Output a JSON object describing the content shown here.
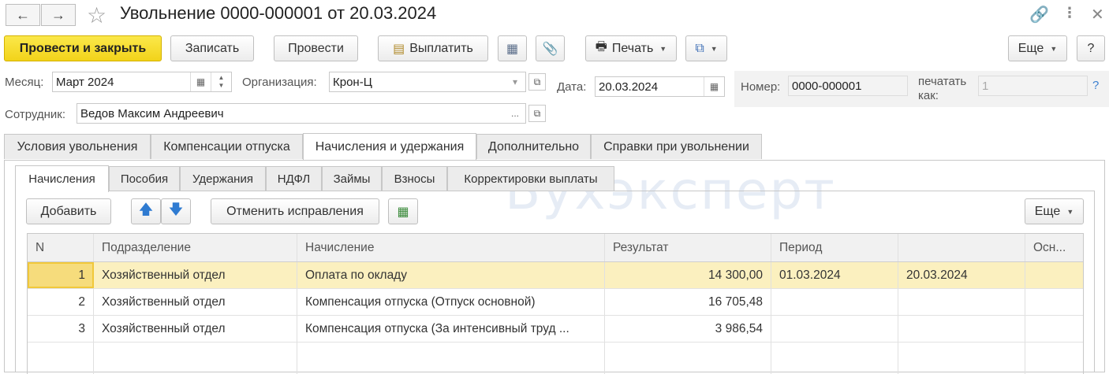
{
  "window": {
    "title": "Увольнение 0000-000001 от 20.03.2024",
    "back_label": "←",
    "forward_label": "→"
  },
  "toolbar": {
    "post_close": "Провести и закрыть",
    "save": "Записать",
    "post": "Провести",
    "pay": "Выплатить",
    "print": "Печать",
    "more": "Еще",
    "help": "?"
  },
  "form": {
    "month_label": "Месяц:",
    "month_value": "Март 2024",
    "org_label": "Организация:",
    "org_value": "Крон-Ц",
    "date_label": "Дата:",
    "date_value": "20.03.2024",
    "number_label": "Номер:",
    "number_value": "0000-000001",
    "print_as_label_1": "печатать",
    "print_as_label_2": "как:",
    "print_as_value": "1",
    "print_as_help": "?",
    "employee_label": "Сотрудник:",
    "employee_value": "Ведов Максим Андреевич",
    "ellipsis": "..."
  },
  "tabs": [
    {
      "label": "Условия увольнения"
    },
    {
      "label": "Компенсации отпуска"
    },
    {
      "label": "Начисления и удержания"
    },
    {
      "label": "Дополнительно"
    },
    {
      "label": "Справки при увольнении"
    }
  ],
  "subtabs": [
    {
      "label": "Начисления"
    },
    {
      "label": "Пособия"
    },
    {
      "label": "Удержания"
    },
    {
      "label": "НДФЛ"
    },
    {
      "label": "Займы"
    },
    {
      "label": "Взносы"
    },
    {
      "label": "Корректировки выплаты"
    }
  ],
  "grid_toolbar": {
    "add": "Добавить",
    "cancel_fix": "Отменить исправления",
    "more": "Еще"
  },
  "watermark": "Бухэксперт",
  "table": {
    "headers": [
      "N",
      "Подразделение",
      "Начисление",
      "Результат",
      "Период",
      "",
      "Осн..."
    ],
    "rows": [
      [
        "1",
        "Хозяйственный отдел",
        "Оплата по окладу",
        "14 300,00",
        "01.03.2024",
        "20.03.2024",
        ""
      ],
      [
        "2",
        "Хозяйственный отдел",
        "Компенсация отпуска (Отпуск основной)",
        "16 705,48",
        "",
        "",
        ""
      ],
      [
        "3",
        "Хозяйственный отдел",
        "Компенсация отпуска (За интенсивный труд ...",
        "3 986,54",
        "",
        "",
        ""
      ]
    ]
  }
}
